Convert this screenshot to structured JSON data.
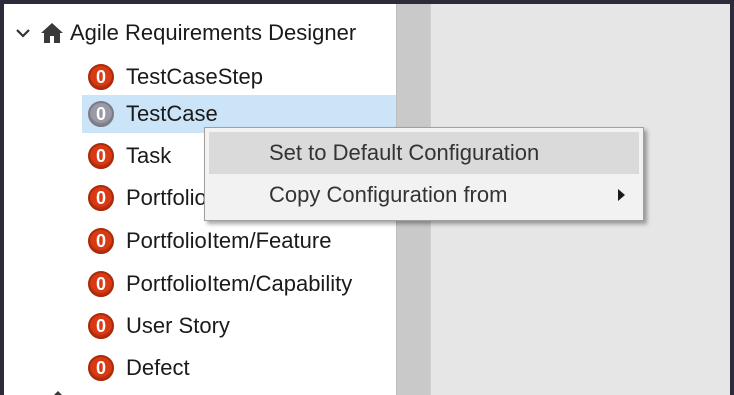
{
  "tree": {
    "root": {
      "label": "Agile Requirements Designer",
      "expand_icon": "chevron-down-icon",
      "home_icon": "home-icon"
    },
    "items": [
      {
        "label": "TestCaseStep",
        "badge": "0",
        "selected": false
      },
      {
        "label": "TestCase",
        "badge": "0",
        "selected": true
      },
      {
        "label": "Task",
        "badge": "0",
        "selected": false
      },
      {
        "label": "PortfolioItem/Epic",
        "badge": "0",
        "selected": false
      },
      {
        "label": "PortfolioItem/Feature",
        "badge": "0",
        "selected": false
      },
      {
        "label": "PortfolioItem/Capability",
        "badge": "0",
        "selected": false
      },
      {
        "label": "User Story",
        "badge": "0",
        "selected": false
      },
      {
        "label": "Defect",
        "badge": "0",
        "selected": false
      }
    ]
  },
  "context_menu": {
    "items": [
      {
        "label": "Set to Default Configuration",
        "hovered": true,
        "has_submenu": false
      },
      {
        "label": "Copy Configuration from",
        "hovered": false,
        "has_submenu": true
      }
    ]
  },
  "colors": {
    "badge": "#d93a14",
    "selection": "#cce4f7",
    "menu_hover": "#dadada",
    "window_frame": "#2b2b3b"
  }
}
